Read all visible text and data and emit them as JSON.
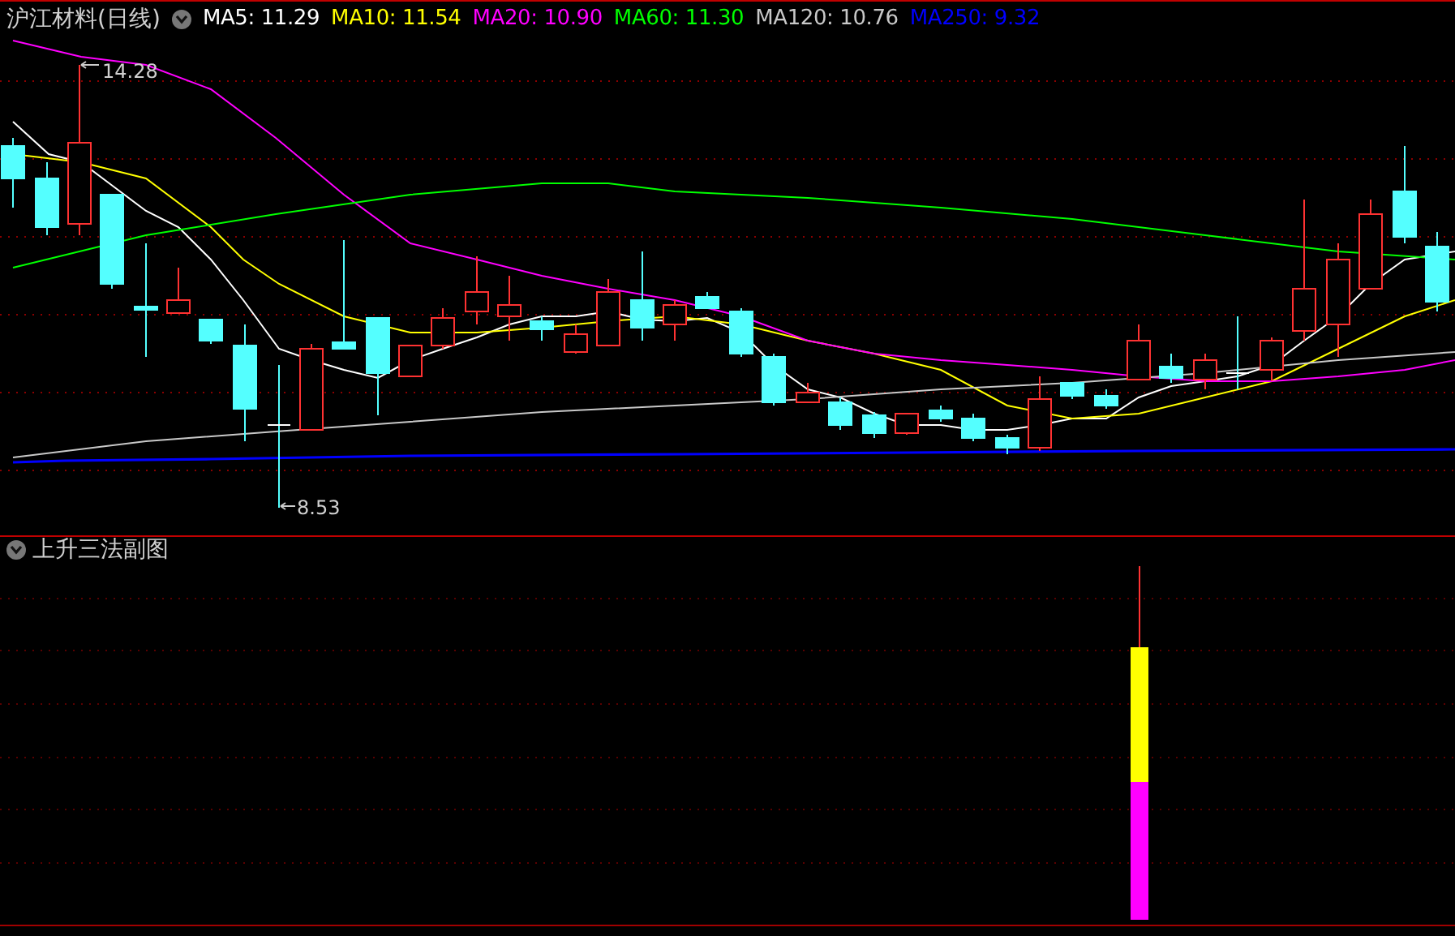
{
  "chart": {
    "title": "沪江材料(日线)",
    "ma_legend": [
      {
        "label": "MA5: 11.29",
        "color": "#ffffff"
      },
      {
        "label": "MA10: 11.54",
        "color": "#ffff00"
      },
      {
        "label": "MA20: 10.90",
        "color": "#ff00ff"
      },
      {
        "label": "MA60: 11.30",
        "color": "#00ff00"
      },
      {
        "label": "MA120: 10.76",
        "color": "#c8c8c8"
      },
      {
        "label": "MA250: 9.32",
        "color": "#0000ff"
      }
    ],
    "high_label": "14.28",
    "low_label": "8.53"
  },
  "indicator": {
    "title": "上升三法副图"
  }
}
